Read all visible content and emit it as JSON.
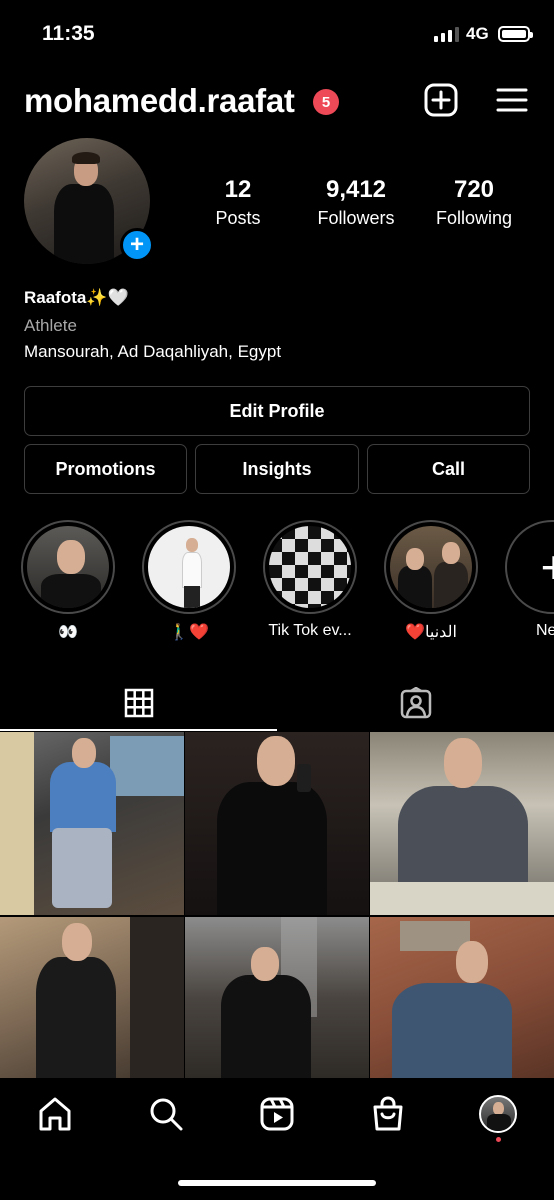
{
  "status_bar": {
    "time": "11:35",
    "network": "4G"
  },
  "header": {
    "username": "mohamedd.raafat",
    "notification_count": "5"
  },
  "stats": [
    {
      "value": "12",
      "label": "Posts"
    },
    {
      "value": "9,412",
      "label": "Followers"
    },
    {
      "value": "720",
      "label": "Following"
    }
  ],
  "bio": {
    "name": "Raafota✨🤍",
    "category": "Athlete",
    "location": "Mansourah, Ad Daqahliyah, Egypt"
  },
  "buttons": {
    "edit_profile": "Edit Profile",
    "promotions": "Promotions",
    "insights": "Insights",
    "call": "Call"
  },
  "highlights": [
    {
      "label": "👀"
    },
    {
      "label": "🚶‍♂️❤️"
    },
    {
      "label": "Tik Tok ev..."
    },
    {
      "label": "❤️الدنيا"
    },
    {
      "label": "New"
    }
  ],
  "tabs": [
    {
      "icon": "grid-icon",
      "active": true
    },
    {
      "icon": "tagged-icon",
      "active": false
    }
  ],
  "posts_visible": 6,
  "bottom_nav": [
    "home-icon",
    "search-icon",
    "reels-icon",
    "shop-icon",
    "profile-avatar"
  ],
  "colors": {
    "badge": "#ed4956",
    "add_badge": "#0095f6",
    "background": "#000000"
  }
}
